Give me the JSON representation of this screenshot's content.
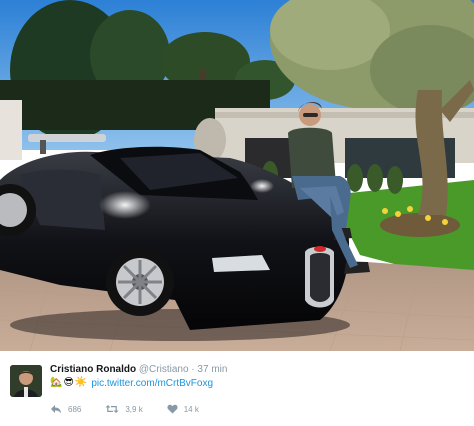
{
  "photo": {
    "subject": "man-seated-on-black-supercar-in-garden"
  },
  "tweet": {
    "display_name": "Cristiano Ronaldo",
    "handle": "@Cristiano",
    "separator": "·",
    "timestamp": "37 min",
    "emojis": [
      "🏡",
      "😎",
      "☀️"
    ],
    "link_text": "pic.twitter.com/mCrtBvFoxg",
    "actions": {
      "reply_icon": "reply-arrow-icon",
      "reply_count": "686",
      "retweet_icon": "retweet-icon",
      "retweet_count": "3,9 k",
      "like_icon": "heart-icon",
      "like_count": "14 k"
    },
    "colors": {
      "name": "#14171a",
      "muted": "#8899a6",
      "link": "#1b95e0"
    }
  }
}
